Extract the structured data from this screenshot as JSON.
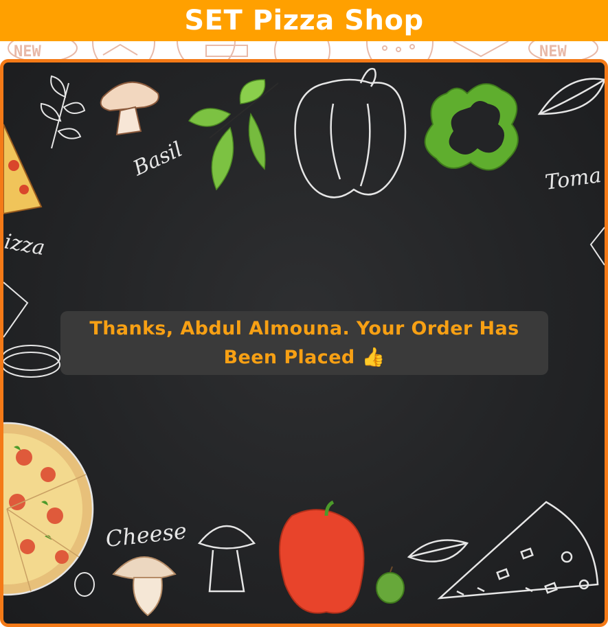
{
  "header": {
    "title": "SET Pizza Shop",
    "background_color": "#ffa000",
    "text_color": "#ffffff"
  },
  "pattern_strip": {
    "label_left": "NEW",
    "label_right": "NEW"
  },
  "board": {
    "border_color": "#f47a17",
    "background_color": "#232426",
    "doodle_labels": {
      "basil": "Basil",
      "tomato": "Toma",
      "pizza": "izza",
      "cheese": "Cheese"
    }
  },
  "confirmation": {
    "message": "Thanks, Abdul Almouna. Your Order Has Been Placed 👍",
    "text_color": "#f7a014",
    "box_color": "#3a3a3a"
  }
}
